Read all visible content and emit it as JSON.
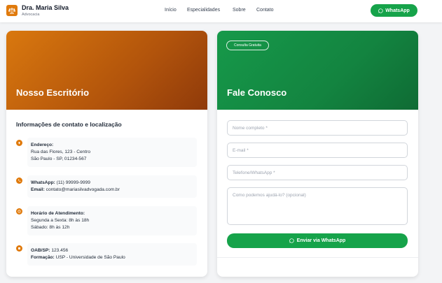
{
  "header": {
    "brand_name": "Dra. Maria Silva",
    "brand_sub": "Advocacia",
    "logo_icon": "scale-icon",
    "nav": [
      "Início",
      "Especialidades",
      "Sobre",
      "Contato"
    ],
    "cta_label": "WhatsApp",
    "cta_icon": "chat-icon"
  },
  "office_card": {
    "title": "Nosso Escritório",
    "heading": "Informações de contato e localização",
    "address": {
      "icon": "location-icon",
      "label": "Endereço:",
      "line1": "Rua das Flores, 123 - Centro",
      "line2": "São Paulo - SP, 01234-567"
    },
    "contact": {
      "icon": "phone-icon",
      "whatsapp_label": "WhatsApp:",
      "whatsapp_value": "(11) 99999-9999",
      "email_label": "Email:",
      "email_value": "contato@mariasilvadvogada.com.br"
    },
    "hours": {
      "icon": "clock-icon",
      "label": "Horário de Atendimento:",
      "line1": "Segunda a Sexta: 8h às 18h",
      "line2": "Sábado: 8h às 12h"
    },
    "credentials": {
      "icon": "badge-icon",
      "oab_label": "OAB/SP:",
      "oab_value": "123.456",
      "education_label": "Formação:",
      "education_value": "USP - Universidade de São Paulo"
    }
  },
  "contact_card": {
    "badge": "Consulta Gratuita",
    "title": "Fale Conosco",
    "fields": {
      "name": "Nome completo *",
      "email": "E-mail *",
      "phone": "Telefone/WhatsApp *",
      "message": "Como podemos ajudá-lo? (opcional)"
    },
    "submit_label": "Enviar via WhatsApp",
    "submit_icon": "chat-icon"
  },
  "colors": {
    "accent_orange": "#e07a0c",
    "accent_green": "#16a34a",
    "background": "#f3f4f6"
  }
}
